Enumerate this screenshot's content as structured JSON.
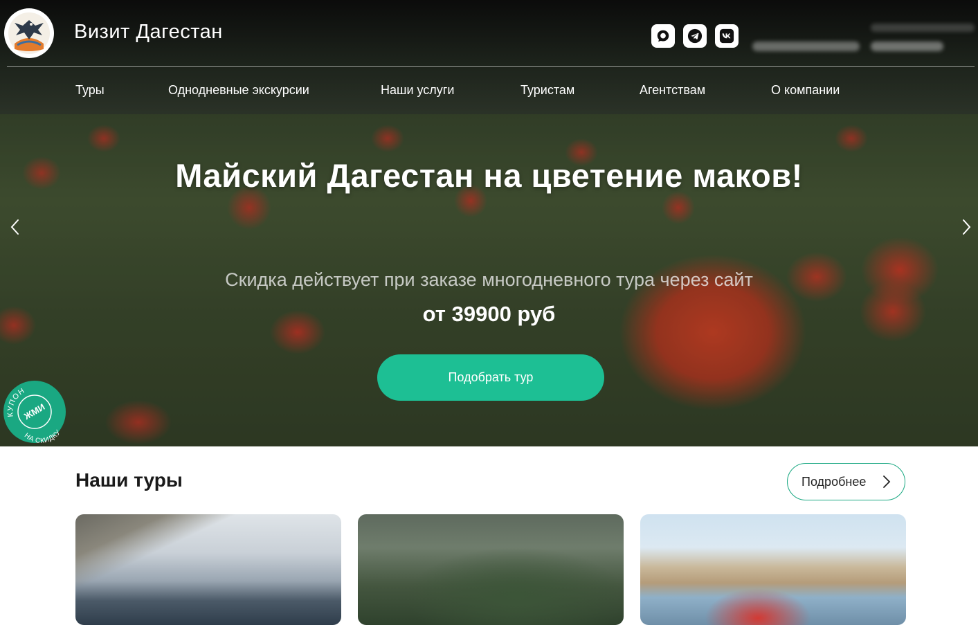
{
  "header": {
    "site_title": "Визит Дагестан",
    "social": [
      {
        "name": "max-messenger"
      },
      {
        "name": "telegram"
      },
      {
        "name": "vk"
      }
    ]
  },
  "nav": {
    "items": [
      "Туры",
      "Однодневные экскурсии",
      "Наши услуги",
      "Туристам",
      "Агентствам",
      "О компании"
    ]
  },
  "hero": {
    "headline": "Майский Дагестан на цветение маков!",
    "subline": "Скидка действует при заказе многодневного тура через сайт",
    "price": "от 39900 руб",
    "cta_label": "Подобрать тур"
  },
  "coupon": {
    "line_top": "КУПОН",
    "line_mid": "ЖМИ",
    "line_bottom": "НА СКИДКУ"
  },
  "tours": {
    "title": "Наши туры",
    "more_label": "Подробнее"
  },
  "colors": {
    "accent": "#1dbf94",
    "accent_dark": "#1aa882"
  }
}
